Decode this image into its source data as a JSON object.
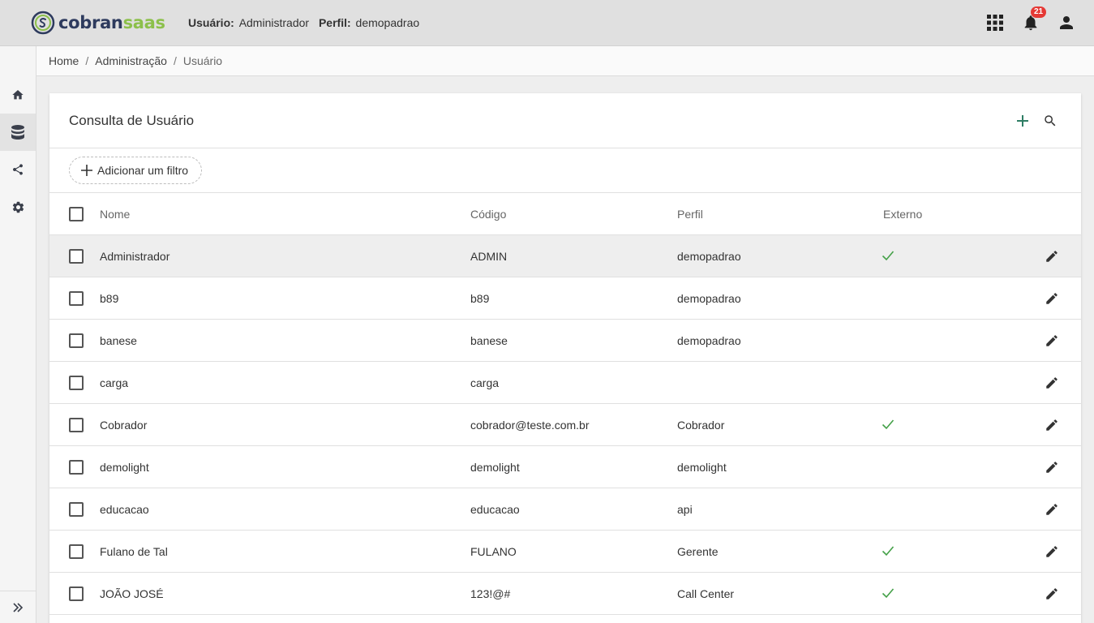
{
  "header": {
    "logo": {
      "part1": "cobran",
      "part2": "saas"
    },
    "user_label": "Usuário:",
    "user_value": "Administrador",
    "profile_label": "Perfil:",
    "profile_value": "demopadrao",
    "notifications_count": "21"
  },
  "breadcrumb": {
    "home": "Home",
    "admin": "Administração",
    "current": "Usuário",
    "separator": "/"
  },
  "card": {
    "title": "Consulta de Usuário",
    "filter_button": "Adicionar um filtro"
  },
  "table": {
    "columns": {
      "nome": "Nome",
      "codigo": "Código",
      "perfil": "Perfil",
      "externo": "Externo"
    },
    "rows": [
      {
        "nome": "Administrador",
        "codigo": "ADMIN",
        "perfil": "demopadrao",
        "externo": true
      },
      {
        "nome": "b89",
        "codigo": "b89",
        "perfil": "demopadrao",
        "externo": false
      },
      {
        "nome": "banese",
        "codigo": "banese",
        "perfil": "demopadrao",
        "externo": false
      },
      {
        "nome": "carga",
        "codigo": "carga",
        "perfil": "",
        "externo": false
      },
      {
        "nome": "Cobrador",
        "codigo": "cobrador@teste.com.br",
        "perfil": "Cobrador",
        "externo": true
      },
      {
        "nome": "demolight",
        "codigo": "demolight",
        "perfil": "demolight",
        "externo": false
      },
      {
        "nome": "educacao",
        "codigo": "educacao",
        "perfil": "api",
        "externo": false
      },
      {
        "nome": "Fulano de Tal",
        "codigo": "FULANO",
        "perfil": "Gerente",
        "externo": true
      },
      {
        "nome": "JOÃO JOSÉ",
        "codigo": "123!@#",
        "perfil": "Call Center",
        "externo": true
      }
    ]
  },
  "colors": {
    "accent_green": "#8cc04b",
    "brand_navy": "#2e3b5e",
    "add_icon": "#2e7d64",
    "check_green": "#43a047",
    "badge_red": "#e53935"
  },
  "icons": {
    "apps": "grid-icon",
    "notifications": "bell-icon",
    "account": "person-icon",
    "home": "home-icon",
    "database": "database-icon",
    "share": "share-icon",
    "settings": "gear-icon",
    "expand": "double-chevron-right-icon",
    "add": "plus-icon",
    "search": "search-icon",
    "edit": "pencil-icon",
    "check": "check-icon"
  }
}
